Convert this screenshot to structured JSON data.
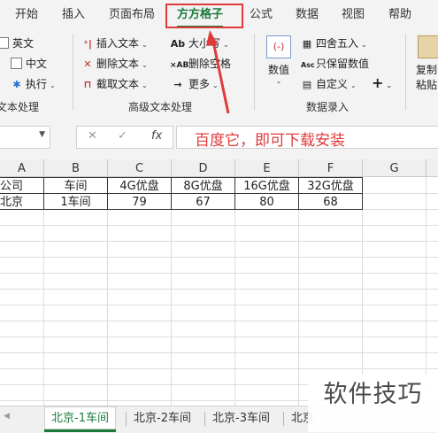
{
  "ribbon_tabs": [
    "开始",
    "插入",
    "页面布局",
    "方方格子",
    "公式",
    "数据",
    "视图",
    "帮助"
  ],
  "active_tab": "方方格子",
  "ribbon": {
    "text_group": {
      "english": "英文",
      "chinese": "中文",
      "execute": "执行",
      "name_fragment": "文本处理"
    },
    "advanced_text_group": {
      "insert_text": "插入文本",
      "delete_text": "删除文本",
      "extract_text": "截取文本",
      "case": "大小写",
      "delete_spaces": "删除空格",
      "more": "更多",
      "name": "高级文本处理"
    },
    "data_entry_group": {
      "number": "数值",
      "round": "四舍五入",
      "keep_value": "只保留数值",
      "custom": "自定义",
      "name": "数据录入"
    },
    "clipboard_group": {
      "copy": "复制",
      "paste": "粘贴"
    }
  },
  "formula_bar": {
    "cancel": "✕",
    "confirm": "✓",
    "fx": "fx",
    "annotation": "百度它，即可下载安装"
  },
  "columns": [
    "A",
    "B",
    "C",
    "D",
    "E",
    "F",
    "G"
  ],
  "table": {
    "header": [
      "公司",
      "车间",
      "4G优盘",
      "8G优盘",
      "16G优盘",
      "32G优盘"
    ],
    "row": [
      "北京",
      "1车间",
      "79",
      "67",
      "80",
      "68"
    ]
  },
  "sheet_tabs": [
    "北京-1车间",
    "北京-2车间",
    "北京-3车间",
    "北京"
  ],
  "active_sheet": "北京-1车间",
  "watermark": "软件技巧",
  "colors": {
    "accent": "#1a7a3a",
    "annotation_red": "#e03a3a"
  }
}
